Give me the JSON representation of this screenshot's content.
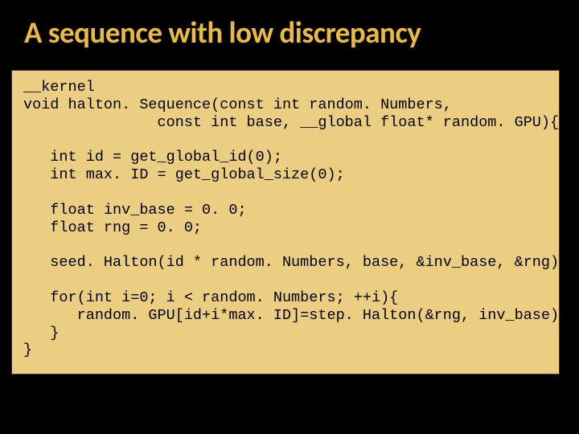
{
  "title": "A sequence with low discrepancy",
  "code": {
    "l0": "__kernel",
    "l1": "void halton. Sequence(const int random. Numbers,",
    "l2": "               const int base, __global float* random. GPU){",
    "l3": "",
    "l4": "   int id = get_global_id(0);",
    "l5": "   int max. ID = get_global_size(0);",
    "l6": "",
    "l7": "   float inv_base = 0. 0;",
    "l8": "   float rng = 0. 0;",
    "l9": "",
    "l10": "   seed. Halton(id * random. Numbers, base, &inv_base, &rng);",
    "l11": "",
    "l12": "   for(int i=0; i < random. Numbers; ++i){",
    "l13": "      random. GPU[id+i*max. ID]=step. Halton(&rng, inv_base);",
    "l14": "   }",
    "l15": "}"
  }
}
